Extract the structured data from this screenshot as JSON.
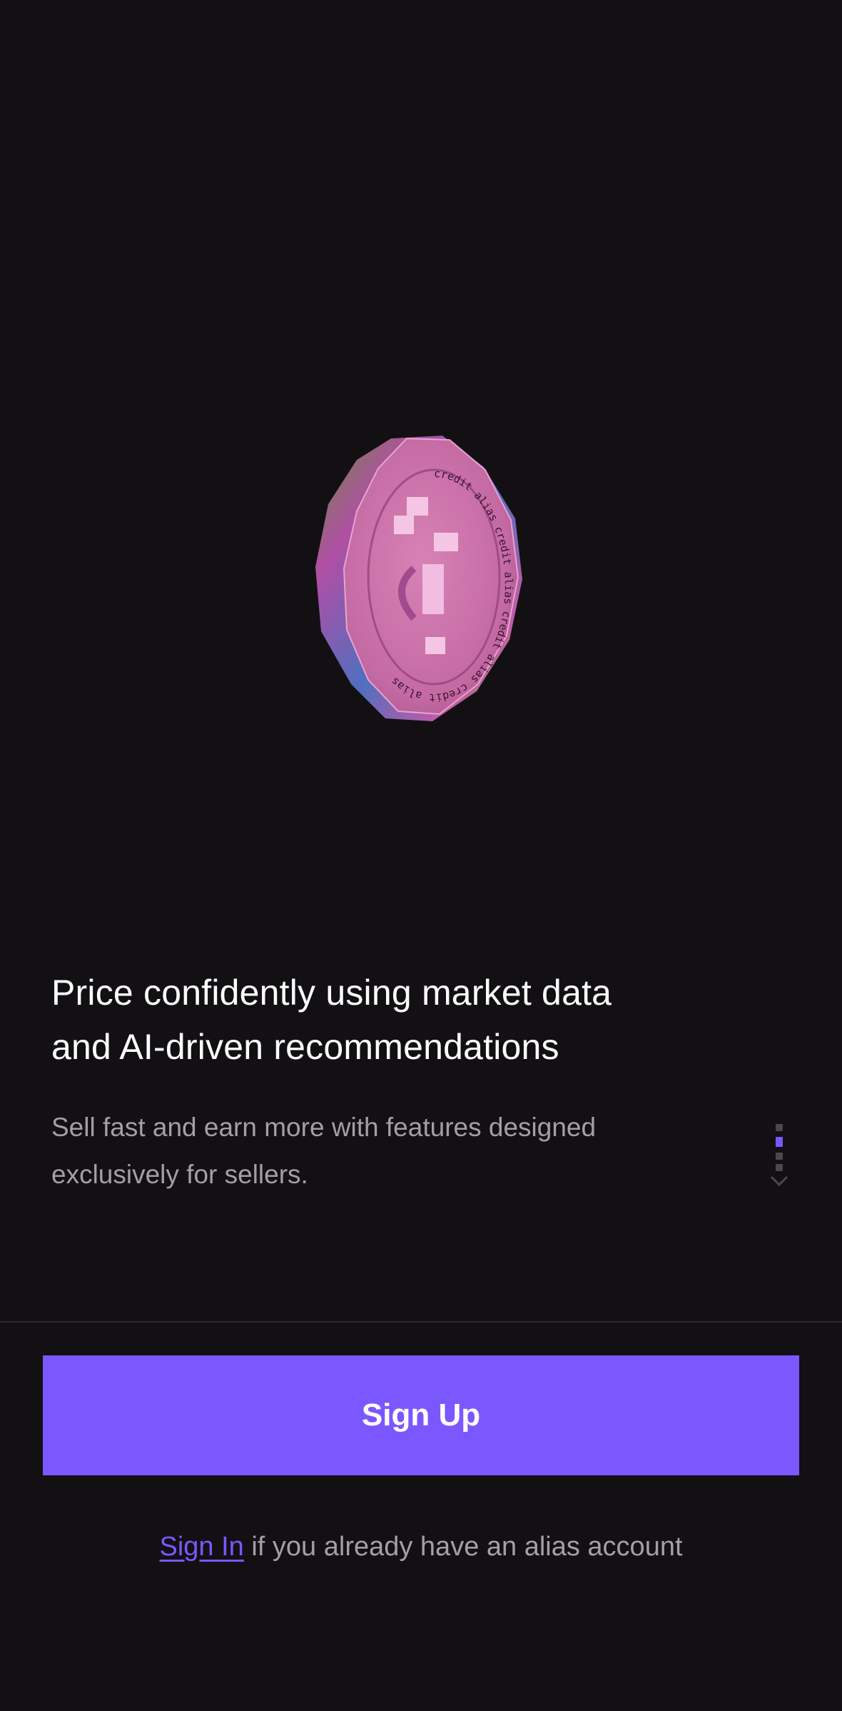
{
  "hero": {
    "image": "credit-coin-illustration",
    "coin_text": "credit alias credit alias credit alias credit alias"
  },
  "content": {
    "headline_line1": "Price confidently using market data",
    "headline_line2": "and AI-driven recommendations",
    "subtext_line1": "Sell fast and earn more with features designed",
    "subtext_line2": "exclusively for sellers."
  },
  "pager": {
    "total": 4,
    "active_index": 3,
    "icon": "chevron-down-icon"
  },
  "actions": {
    "signup_label": "Sign Up",
    "signin_link": "Sign In",
    "signin_suffix": " if you already have an alias account"
  },
  "colors": {
    "background": "#121013",
    "accent": "#7b57ff",
    "text_primary": "#ffffff",
    "text_secondary": "#a29fa6"
  }
}
